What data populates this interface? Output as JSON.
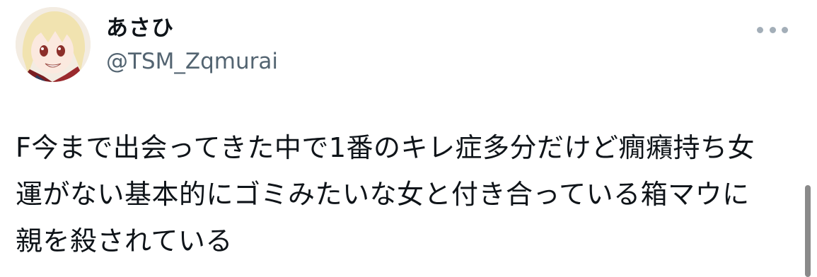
{
  "author": {
    "display_name": "あさひ",
    "handle": "@TSM_Zqmurai",
    "avatar_icon": "anime-character-avatar"
  },
  "more_icon": "more-horizontal-icon",
  "tweet": {
    "lines": [
      "F今まで出会ってきた中で1番のキレ症多分だけど癇癪持ち女",
      "運がない基本的にゴミみたいな女と付き合っている箱マウに",
      "親を殺されている"
    ]
  },
  "colors": {
    "text": "#0f1419",
    "handle": "#536471",
    "dots": "#a3aeb8",
    "scrollbar": "#8a8a8a"
  }
}
